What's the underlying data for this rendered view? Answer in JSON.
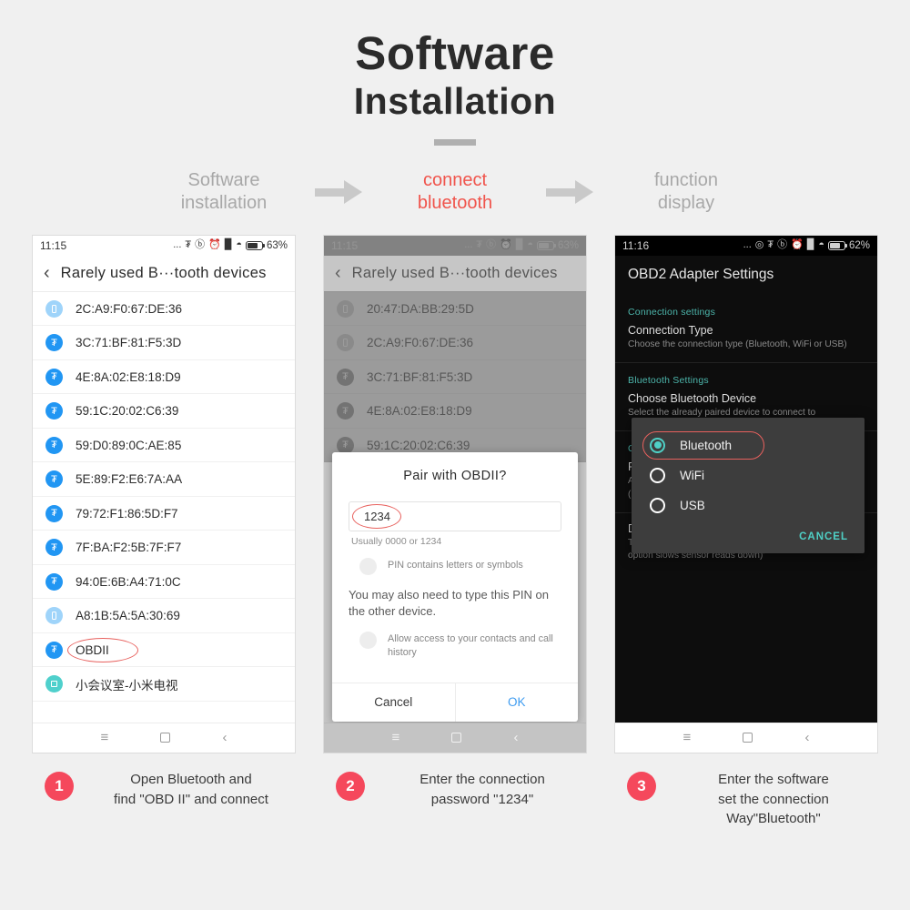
{
  "header": {
    "title_line1": "Software",
    "title_line2": "Installation"
  },
  "flow": {
    "steps": [
      {
        "label": "Software\ninstallation",
        "line1": "Software",
        "line2": "installation",
        "active": false
      },
      {
        "label": "connect bluetooth",
        "line1": "connect",
        "line2": "bluetooth",
        "active": true
      },
      {
        "label": "function display",
        "line1": "function",
        "line2": "display",
        "active": false
      }
    ],
    "arrow_icon": "arrow-right-icon",
    "active_color": "#f0544c",
    "inactive_color": "#a8a8a8"
  },
  "phone1": {
    "statusbar": {
      "time": "11:15",
      "dots": "...",
      "icons": [
        "bluetooth-icon",
        "mute-icon",
        "alarm-icon",
        "signal-icon",
        "wifi-icon"
      ],
      "battery_percent": "63%"
    },
    "appbar": {
      "back_icon": "chevron-left-icon",
      "title": "Rarely used B···tooth devices"
    },
    "devices": [
      {
        "name": "2C:A9:F0:67:DE:36",
        "icon": "phone-device-icon",
        "highlighted": false
      },
      {
        "name": "3C:71:BF:81:F5:3D",
        "icon": "bluetooth-device-icon",
        "highlighted": false
      },
      {
        "name": "4E:8A:02:E8:18:D9",
        "icon": "bluetooth-device-icon",
        "highlighted": false
      },
      {
        "name": "59:1C:20:02:C6:39",
        "icon": "bluetooth-device-icon",
        "highlighted": false
      },
      {
        "name": "59:D0:89:0C:AE:85",
        "icon": "bluetooth-device-icon",
        "highlighted": false
      },
      {
        "name": "5E:89:F2:E6:7A:AA",
        "icon": "bluetooth-device-icon",
        "highlighted": false
      },
      {
        "name": "79:72:F1:86:5D:F7",
        "icon": "bluetooth-device-icon",
        "highlighted": false
      },
      {
        "name": "7F:BA:F2:5B:7F:F7",
        "icon": "bluetooth-device-icon",
        "highlighted": false
      },
      {
        "name": "94:0E:6B:A4:71:0C",
        "icon": "bluetooth-device-icon",
        "highlighted": false
      },
      {
        "name": "A8:1B:5A:5A:30:69",
        "icon": "phone-device-icon",
        "highlighted": false
      },
      {
        "name": "OBDII",
        "icon": "bluetooth-device-icon",
        "highlighted": true
      },
      {
        "name": "小会议室-小米电视",
        "icon": "tv-device-icon",
        "highlighted": false
      }
    ],
    "navbar": {
      "menu_icon": "menu-icon",
      "home_icon": "home-icon",
      "back_icon": "back-icon"
    }
  },
  "phone2": {
    "statusbar": {
      "time": "11:15",
      "dots": "...",
      "battery_percent": "63%"
    },
    "appbar": {
      "back_icon": "chevron-left-icon",
      "title": "Rarely used B···tooth devices"
    },
    "devices": [
      {
        "name": "20:47:DA:BB:29:5D",
        "icon": "phone-device-icon"
      },
      {
        "name": "2C:A9:F0:67:DE:36",
        "icon": "phone-device-icon"
      },
      {
        "name": "3C:71:BF:81:F5:3D",
        "icon": "bluetooth-device-icon"
      },
      {
        "name": "4E:8A:02:E8:18:D9",
        "icon": "bluetooth-device-icon"
      },
      {
        "name": "59:1C:20:02:C6:39",
        "icon": "bluetooth-device-icon"
      }
    ],
    "dialog": {
      "title": "Pair with OBDII?",
      "pin_value": "1234",
      "pin_hint": "Usually 0000 or 1234",
      "checkbox1_label": "PIN contains letters or symbols",
      "note": "You may also need to type this PIN on the other device.",
      "checkbox2_label": "Allow access to your contacts and call history",
      "cancel_label": "Cancel",
      "ok_label": "OK",
      "highlight_color": "#e8615e"
    },
    "navbar": {
      "menu_icon": "menu-icon",
      "home_icon": "home-icon",
      "back_icon": "back-icon"
    }
  },
  "phone3": {
    "statusbar": {
      "time": "11:16",
      "dots": "...",
      "battery_percent": "62%"
    },
    "appbar": {
      "title": "OBD2 Adapter Settings"
    },
    "sections": [
      {
        "header": "Connection settings",
        "items": [
          {
            "title": "Connection Type",
            "subtitle": "Choose the connection type (Bluetooth, WiFi or USB)",
            "checkbox": false
          }
        ]
      },
      {
        "header": "Bluetooth Settings",
        "items": [
          {
            "title": "Choose Bluetooth Device",
            "subtitle": "Select the already paired device to connect to",
            "checkbox": false
          }
        ]
      },
      {
        "header": "OBD2/ELM Adapter preferences",
        "items": [
          {
            "title": "Faster communication",
            "subtitle": "Attempt faster communications with the interface (may not work on some devices)",
            "checkbox": true
          },
          {
            "title": "Disable ELM327 auto timing adjust(Slow..",
            "subtitle": "Tick this if you have problem talking to the car (This option slows sensor reads down)'",
            "checkbox": true
          }
        ]
      }
    ],
    "radio_dialog": {
      "options": [
        {
          "label": "Bluetooth",
          "selected": true,
          "highlighted": true
        },
        {
          "label": "WiFi",
          "selected": false,
          "highlighted": false
        },
        {
          "label": "USB",
          "selected": false,
          "highlighted": false
        }
      ],
      "cancel_label": "CANCEL",
      "accent_color": "#4fd0c6",
      "highlight_color": "#e8615e"
    },
    "navbar": {
      "menu_icon": "menu-icon",
      "home_icon": "home-icon",
      "back_icon": "back-icon"
    }
  },
  "captions": [
    {
      "number": "1",
      "line1": "Open Bluetooth and",
      "line2": "find \"OBD II\" and connect",
      "line3": ""
    },
    {
      "number": "2",
      "line1": "Enter the connection",
      "line2": "password \"1234\"",
      "line3": ""
    },
    {
      "number": "3",
      "line1": "Enter the software",
      "line2": "set the connection",
      "line3": "Way\"Bluetooth\""
    }
  ],
  "colors": {
    "background": "#f0f0f0",
    "accent_red": "#f5485c",
    "flow_active": "#f0544c",
    "teal": "#4fd0c6",
    "bluetooth_blue": "#2196f3"
  }
}
